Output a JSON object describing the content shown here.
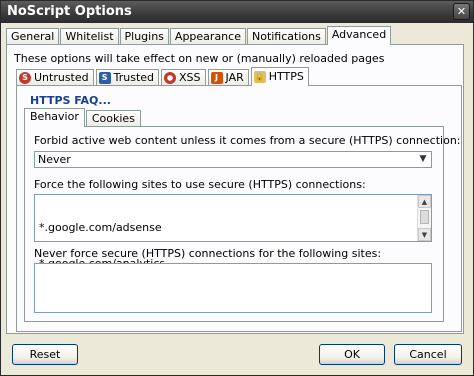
{
  "window": {
    "title": "NoScript Options",
    "close_glyph": "✕"
  },
  "tabs": [
    {
      "label": "General"
    },
    {
      "label": "Whitelist"
    },
    {
      "label": "Plugins"
    },
    {
      "label": "Appearance"
    },
    {
      "label": "Notifications"
    },
    {
      "label": "Advanced",
      "active": true
    }
  ],
  "advanced": {
    "description": "These options will take effect on new or (manually) reloaded pages",
    "subtabs": [
      {
        "label": "Untrusted",
        "icon": "untrusted-icon",
        "glyph": "S"
      },
      {
        "label": "Trusted",
        "icon": "trusted-icon",
        "glyph": "S"
      },
      {
        "label": "XSS",
        "icon": "xss-icon",
        "glyph": ""
      },
      {
        "label": "JAR",
        "icon": "jar-icon",
        "glyph": "J"
      },
      {
        "label": "HTTPS",
        "icon": "https-icon",
        "glyph": "🔒",
        "active": true
      }
    ]
  },
  "https": {
    "faq_link": "HTTPS FAQ...",
    "tabs": [
      {
        "label": "Behavior",
        "active": true
      },
      {
        "label": "Cookies"
      }
    ],
    "forbid_label": "Forbid active web content unless it comes from a secure (HTTPS) connection:",
    "forbid_value": "Never",
    "force_label": "Force the following sites to use secure (HTTPS) connections:",
    "force_sites": [
      "*.google.com/adsense",
      "*.google.com/analytics"
    ],
    "never_force_label": "Never force secure (HTTPS) connections for the following sites:",
    "never_force_sites": []
  },
  "buttons": {
    "reset": "Reset",
    "ok": "OK",
    "cancel": "Cancel"
  }
}
